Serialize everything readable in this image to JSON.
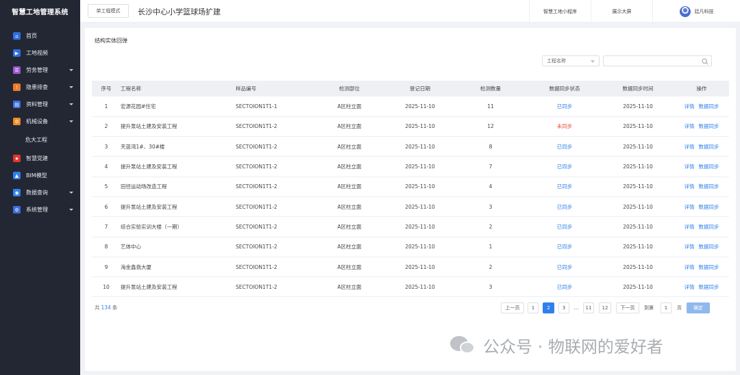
{
  "app": {
    "title": "智慧工地管理系统"
  },
  "sidebar": {
    "items": [
      {
        "label": "首页",
        "icon": "home-icon",
        "color": "#2f6fe0",
        "glyph": "⌂",
        "expandable": false
      },
      {
        "label": "工地视频",
        "icon": "video-icon",
        "color": "#2f6fe0",
        "glyph": "▶",
        "expandable": false
      },
      {
        "label": "劳务管理",
        "icon": "labor-icon",
        "color": "#9b59d0",
        "glyph": "☰",
        "expandable": true
      },
      {
        "label": "隐患排查",
        "icon": "hazard-icon",
        "color": "#f07b2c",
        "glyph": "!",
        "expandable": true
      },
      {
        "label": "资料管理",
        "icon": "document-icon",
        "color": "#3b6fe0",
        "glyph": "▤",
        "expandable": true
      },
      {
        "label": "机械设备",
        "icon": "machine-icon",
        "color": "#f08a24",
        "glyph": "⚙",
        "expandable": true
      },
      {
        "label": "危大工程",
        "icon": "",
        "color": "",
        "glyph": "",
        "expandable": false,
        "sub": true
      },
      {
        "label": "智慧党建",
        "icon": "party-icon",
        "color": "#e0342f",
        "glyph": "★",
        "expandable": false
      },
      {
        "label": "BIM模型",
        "icon": "bim-icon",
        "color": "#2f80ed",
        "glyph": "▲",
        "expandable": false
      },
      {
        "label": "数据查询",
        "icon": "data-query-icon",
        "color": "#2f80ed",
        "glyph": "◉",
        "expandable": true
      },
      {
        "label": "系统管理",
        "icon": "settings-icon",
        "color": "#3b6fe0",
        "glyph": "⚙",
        "expandable": true
      }
    ]
  },
  "topbar": {
    "mode_button": "单工程模式",
    "project_title": "长沙中心小学篮球场扩建",
    "links": [
      "智慧工地小程序",
      "展示大屏"
    ],
    "user_name": "廷凡科技"
  },
  "panel": {
    "title": "结构实体回弹",
    "filter": {
      "project_placeholder": "工程名称"
    }
  },
  "table": {
    "headers": [
      "序号",
      "工程名称",
      "样品编号",
      "检测部位",
      "登记日期",
      "检测数量",
      "数据同步状态",
      "数据同步时间",
      "操作"
    ],
    "rows": [
      {
        "no": "1",
        "name": "宏源花园#住宅",
        "sample": "SECTOION1T1-1",
        "part": "A区柱立面",
        "date": "2025-11-10",
        "count": "11",
        "status": "已同步",
        "synced": true,
        "sync_time": "2025-11-10"
      },
      {
        "no": "2",
        "name": "提升泵站土建及安装工程",
        "sample": "SECTOION1T1-2",
        "part": "A区柱立面",
        "date": "2025-11-10",
        "count": "12",
        "status": "未同步",
        "synced": false,
        "sync_time": "2025-11-10"
      },
      {
        "no": "3",
        "name": "天蓝湾1#、30#楼",
        "sample": "SECTOION1T1-2",
        "part": "A区柱立面",
        "date": "2025-11-10",
        "count": "8",
        "status": "已同步",
        "synced": true,
        "sync_time": "2025-11-10"
      },
      {
        "no": "4",
        "name": "提升泵站土建及安装工程",
        "sample": "SECTOION1T1-2",
        "part": "A区柱立面",
        "date": "2025-11-10",
        "count": "7",
        "status": "已同步",
        "synced": true,
        "sync_time": "2025-11-10"
      },
      {
        "no": "5",
        "name": "田径运动场改造工程",
        "sample": "SECTOION1T1-2",
        "part": "A区柱立面",
        "date": "2025-11-10",
        "count": "4",
        "status": "已同步",
        "synced": true,
        "sync_time": "2025-11-10"
      },
      {
        "no": "6",
        "name": "提升泵站土建及安装工程",
        "sample": "SECTOION1T1-2",
        "part": "A区柱立面",
        "date": "2025-11-10",
        "count": "3",
        "status": "已同步",
        "synced": true,
        "sync_time": "2025-11-10"
      },
      {
        "no": "7",
        "name": "综合实验实训大楼（一期）",
        "sample": "SECTOION1T1-2",
        "part": "A区柱立面",
        "date": "2025-11-10",
        "count": "2",
        "status": "已同步",
        "synced": true,
        "sync_time": "2025-11-10"
      },
      {
        "no": "8",
        "name": "艺体中心",
        "sample": "SECTOION1T1-2",
        "part": "A区柱立面",
        "date": "2025-11-10",
        "count": "1",
        "status": "已同步",
        "synced": true,
        "sync_time": "2025-11-10"
      },
      {
        "no": "9",
        "name": "海金鑫翡大厦",
        "sample": "SECTOION1T1-2",
        "part": "A区柱立面",
        "date": "2025-11-10",
        "count": "2",
        "status": "已同步",
        "synced": true,
        "sync_time": "2025-11-10"
      },
      {
        "no": "10",
        "name": "提升泵站土建及安装工程",
        "sample": "SECTOION1T1-2",
        "part": "A区柱立面",
        "date": "2025-11-10",
        "count": "3",
        "status": "已同步",
        "synced": true,
        "sync_time": "2025-11-10"
      }
    ],
    "actions": [
      "详情",
      "数据同步"
    ]
  },
  "pagination": {
    "total_prefix": "共",
    "total": "134",
    "total_suffix": "条",
    "prev": "上一页",
    "next": "下一页",
    "pages": [
      "1",
      "2",
      "3",
      "...",
      "11",
      "12"
    ],
    "current": "2",
    "goto_prefix": "到第",
    "goto_value": "1",
    "goto_suffix": "页",
    "confirm": "确定"
  },
  "watermark": {
    "text": "公众号 · 物联网的爱好者"
  },
  "colors": {
    "sidebar_bg": "#232733",
    "accent": "#2f80ed",
    "danger": "#e8483b"
  }
}
